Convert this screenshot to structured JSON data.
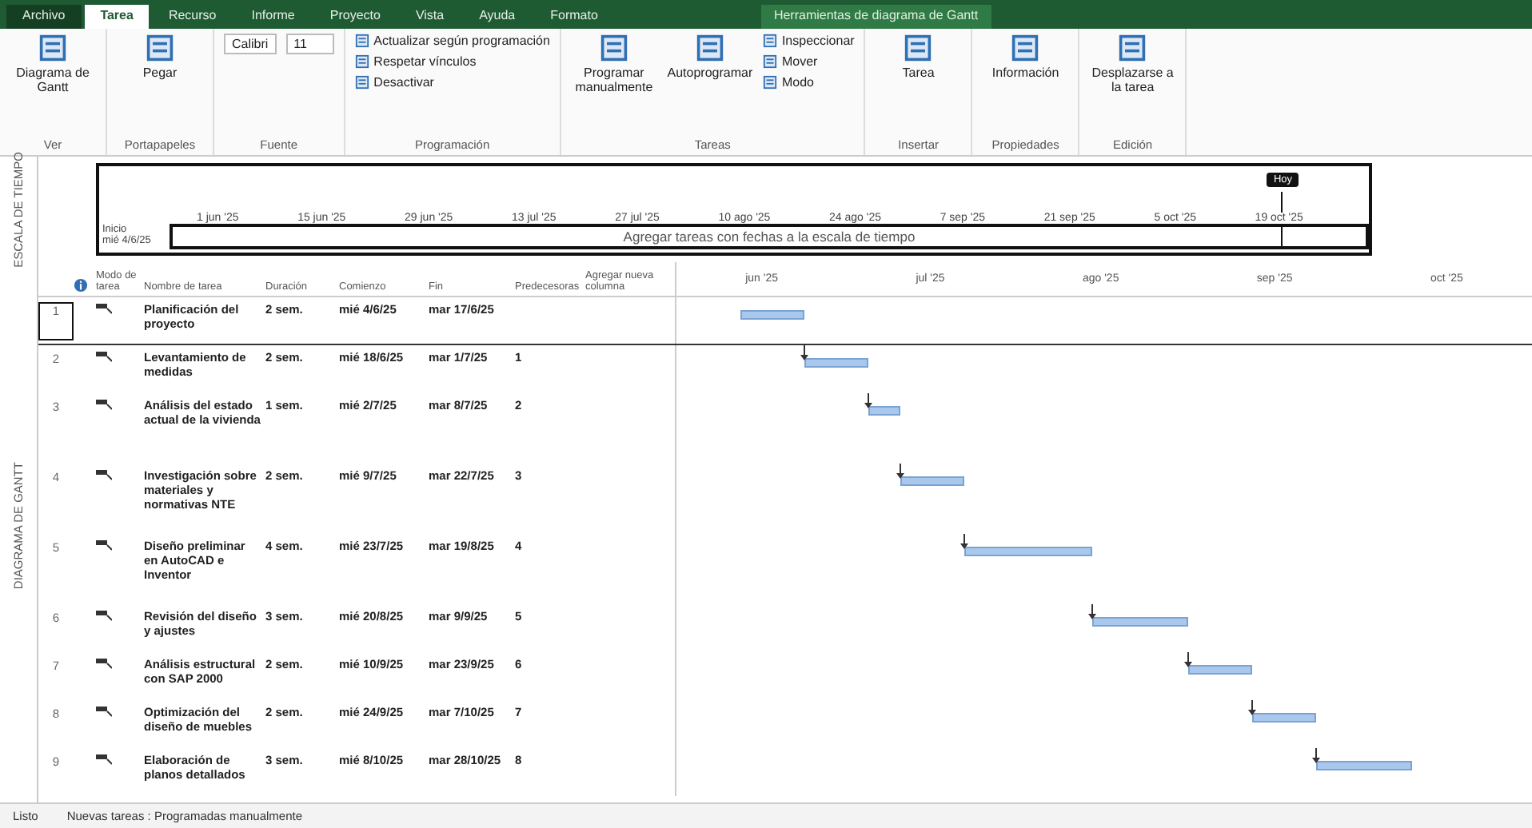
{
  "title_bar": {
    "tabs": [
      {
        "label": "Archivo",
        "selected": false
      },
      {
        "label": "Tarea",
        "selected": true
      },
      {
        "label": "Recurso",
        "selected": false
      },
      {
        "label": "Informe",
        "selected": false
      },
      {
        "label": "Proyecto",
        "selected": false
      },
      {
        "label": "Vista",
        "selected": false
      },
      {
        "label": "Ayuda",
        "selected": false
      },
      {
        "label": "Formato",
        "selected": false
      }
    ],
    "context": "Herramientas de diagrama de Gantt"
  },
  "ribbon": {
    "groups": [
      {
        "label": "Ver",
        "items": [
          {
            "label": "Diagrama de Gantt",
            "kind": "large"
          }
        ]
      },
      {
        "label": "Portapapeles",
        "items": [
          {
            "label": "Pegar",
            "kind": "large"
          }
        ]
      },
      {
        "label": "Fuente",
        "items": [
          {
            "label": "Calibri",
            "kind": "field"
          },
          {
            "label": "11",
            "kind": "field"
          }
        ]
      },
      {
        "label": "Programación",
        "items": [
          {
            "label": "Actualizar según programación",
            "kind": "small"
          },
          {
            "label": "Respetar vínculos",
            "kind": "small"
          },
          {
            "label": "Desactivar",
            "kind": "small"
          }
        ]
      },
      {
        "label": "Tareas",
        "items": [
          {
            "label": "Programar manualmente",
            "kind": "large"
          },
          {
            "label": "Autoprogramar",
            "kind": "large"
          },
          {
            "label": "Inspeccionar",
            "kind": "small"
          },
          {
            "label": "Mover",
            "kind": "small"
          },
          {
            "label": "Modo",
            "kind": "small"
          }
        ]
      },
      {
        "label": "Insertar",
        "items": [
          {
            "label": "Tarea",
            "kind": "large"
          }
        ]
      },
      {
        "label": "Propiedades",
        "items": [
          {
            "label": "Información",
            "kind": "large"
          }
        ]
      },
      {
        "label": "Edición",
        "items": [
          {
            "label": "Desplazarse a la tarea",
            "kind": "large"
          }
        ]
      }
    ]
  },
  "side_labels": [
    "ESCALA DE TIEMPO",
    "DIAGRAMA DE GANTT"
  ],
  "timeline": {
    "start_label": "Inicio",
    "start_date": "mié 4/6/25",
    "today_label": "Hoy",
    "hint": "Agregar tareas con fechas a la escala de tiempo",
    "ticks": [
      "1 jun '25",
      "15 jun '25",
      "29 jun '25",
      "13 jul '25",
      "27 jul '25",
      "10 ago '25",
      "24 ago '25",
      "7 sep '25",
      "21 sep '25",
      "5 oct '25",
      "19 oct '25"
    ]
  },
  "table": {
    "columns": [
      "Modo de tarea",
      "Nombre de tarea",
      "Duración",
      "Comienzo",
      "Fin",
      "Predecesoras",
      "Agregar nueva columna"
    ],
    "rows": [
      {
        "id": "1",
        "name": "Planificación del proyecto",
        "duration": "2 sem.",
        "start": "mié 4/6/25",
        "finish": "mar 17/6/25",
        "predecessors": "",
        "selected": true
      },
      {
        "id": "2",
        "name": "Levantamiento de medidas",
        "duration": "2 sem.",
        "start": "mié 18/6/25",
        "finish": "mar 1/7/25",
        "predecessors": "1",
        "selected": false
      },
      {
        "id": "3",
        "name": "Análisis del estado actual de la vivienda",
        "duration": "1 sem.",
        "start": "mié 2/7/25",
        "finish": "mar 8/7/25",
        "predecessors": "2",
        "selected": false
      },
      {
        "id": "4",
        "name": "Investigación sobre materiales y normativas NTE",
        "duration": "2 sem.",
        "start": "mié 9/7/25",
        "finish": "mar 22/7/25",
        "predecessors": "3",
        "selected": false
      },
      {
        "id": "5",
        "name": "Diseño preliminar en AutoCAD e Inventor",
        "duration": "4 sem.",
        "start": "mié 23/7/25",
        "finish": "mar 19/8/25",
        "predecessors": "4",
        "selected": false
      },
      {
        "id": "6",
        "name": "Revisión del diseño y ajustes",
        "duration": "3 sem.",
        "start": "mié 20/8/25",
        "finish": "mar 9/9/25",
        "predecessors": "5",
        "selected": false
      },
      {
        "id": "7",
        "name": "Análisis estructural con SAP 2000",
        "duration": "2 sem.",
        "start": "mié 10/9/25",
        "finish": "mar 23/9/25",
        "predecessors": "6",
        "selected": false
      },
      {
        "id": "8",
        "name": "Optimización del diseño de muebles",
        "duration": "2 sem.",
        "start": "mié 24/9/25",
        "finish": "mar 7/10/25",
        "predecessors": "7",
        "selected": false
      },
      {
        "id": "9",
        "name": "Elaboración de planos detallados",
        "duration": "3 sem.",
        "start": "mié 8/10/25",
        "finish": "mar 28/10/25",
        "predecessors": "8",
        "selected": false
      }
    ]
  },
  "gantt": {
    "months": [
      "jun '25",
      "jul '25",
      "ago '25",
      "sep '25",
      "oct '25"
    ]
  },
  "status_bar": [
    "Listo",
    "Nuevas tareas : Programadas manualmente"
  ]
}
